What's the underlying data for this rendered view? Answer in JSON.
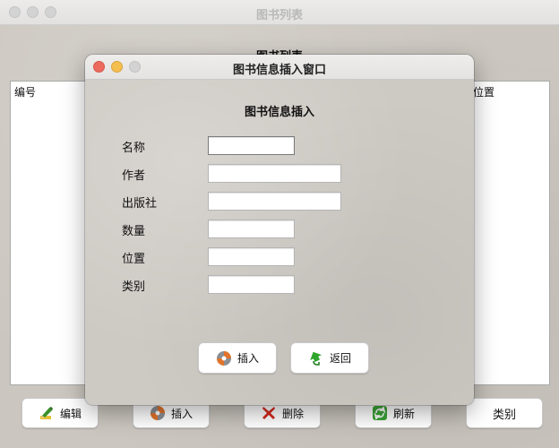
{
  "main_window": {
    "title": "图书列表",
    "heading": "图书列表",
    "table": {
      "columns": [
        "编号",
        "位置"
      ]
    },
    "buttons": {
      "edit": "编辑",
      "insert": "插入",
      "delete": "删除",
      "refresh": "刷新",
      "category": "类别"
    }
  },
  "dialog": {
    "title": "图书信息插入窗口",
    "heading": "图书信息插入",
    "fields": {
      "name": {
        "label": "名称",
        "value": ""
      },
      "author": {
        "label": "作者",
        "value": ""
      },
      "publisher": {
        "label": "出版社",
        "value": ""
      },
      "quantity": {
        "label": "数量",
        "value": ""
      },
      "location": {
        "label": "位置",
        "value": ""
      },
      "category": {
        "label": "类别",
        "value": ""
      }
    },
    "buttons": {
      "insert": "插入",
      "back": "返回"
    }
  },
  "colors": {
    "close": "#ed6a5e",
    "minimize": "#f5bf4f",
    "background": "#cbc6bf"
  },
  "icons": [
    "edit-pencil-icon",
    "insert-orb-icon",
    "delete-x-icon",
    "refresh-icon",
    "back-arrow-icon"
  ]
}
